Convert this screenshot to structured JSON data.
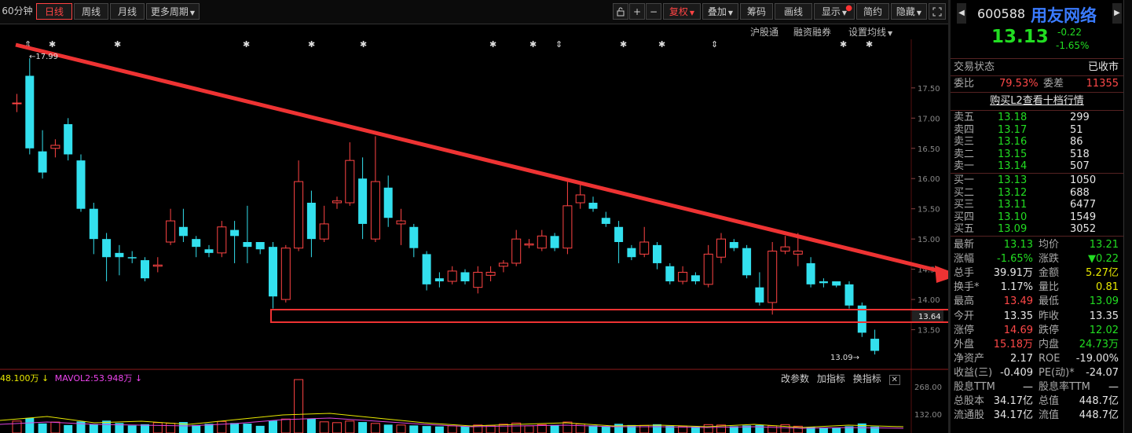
{
  "toolbar": {
    "period": "60分钟",
    "day": "日线",
    "week": "周线",
    "month": "月线",
    "more": "更多周期",
    "plus": "+",
    "minus": "−",
    "restore": "复权",
    "overlay": "叠加",
    "chips": "筹码",
    "draw": "画线",
    "display": "显示",
    "simple": "简约",
    "hide": "隐藏"
  },
  "subrow": {
    "hgt": "沪股通",
    "margin": "融资融券",
    "ma_setting": "设置均线"
  },
  "chart": {
    "y_ticks": [
      "17.50",
      "17.00",
      "16.50",
      "16.00",
      "15.50",
      "15.00",
      "14.50",
      "14.00",
      "13.50"
    ],
    "hi_label": "17.99",
    "lo_label": "13.09",
    "box_price": "13.64",
    "vol_legend_1": "48.100万 ↓",
    "vol_legend_2": "MAVOL2:53.948万 ↓",
    "vol_ticks": [
      "268.00",
      "132.00"
    ],
    "vol_buttons": [
      "改参数",
      "加指标",
      "换指标"
    ],
    "vol_close": "✕"
  },
  "chart_data": {
    "type": "candlestick",
    "ylim": [
      13.0,
      18.2
    ],
    "candles": [
      {
        "o": 17.25,
        "c": 17.25,
        "h": 17.4,
        "l": 17.1
      },
      {
        "o": 17.7,
        "c": 16.5,
        "h": 17.99,
        "l": 16.4
      },
      {
        "o": 16.45,
        "c": 16.1,
        "h": 16.8,
        "l": 16.0
      },
      {
        "o": 16.5,
        "c": 16.55,
        "h": 16.65,
        "l": 16.35
      },
      {
        "o": 16.9,
        "c": 16.4,
        "h": 17.0,
        "l": 16.3
      },
      {
        "o": 16.3,
        "c": 15.5,
        "h": 16.4,
        "l": 15.45
      },
      {
        "o": 15.5,
        "c": 15.0,
        "h": 15.6,
        "l": 14.75
      },
      {
        "o": 15.0,
        "c": 14.7,
        "h": 15.1,
        "l": 14.3
      },
      {
        "o": 14.77,
        "c": 14.7,
        "h": 14.9,
        "l": 14.4
      },
      {
        "o": 14.7,
        "c": 14.68,
        "h": 14.8,
        "l": 14.6
      },
      {
        "o": 14.65,
        "c": 14.35,
        "h": 14.7,
        "l": 14.3
      },
      {
        "o": 14.55,
        "c": 14.57,
        "h": 14.7,
        "l": 14.45
      },
      {
        "o": 14.95,
        "c": 15.3,
        "h": 15.5,
        "l": 14.9
      },
      {
        "o": 15.2,
        "c": 15.05,
        "h": 15.5,
        "l": 14.95
      },
      {
        "o": 15.0,
        "c": 14.87,
        "h": 15.05,
        "l": 14.7
      },
      {
        "o": 14.83,
        "c": 14.77,
        "h": 14.9,
        "l": 14.7
      },
      {
        "o": 14.77,
        "c": 15.2,
        "h": 15.3,
        "l": 14.7
      },
      {
        "o": 15.15,
        "c": 15.05,
        "h": 15.3,
        "l": 14.6
      },
      {
        "o": 14.95,
        "c": 14.87,
        "h": 15.55,
        "l": 14.6
      },
      {
        "o": 14.95,
        "c": 14.83,
        "h": 14.95,
        "l": 14.75
      },
      {
        "o": 14.87,
        "c": 14.05,
        "h": 14.95,
        "l": 13.85
      },
      {
        "o": 14.0,
        "c": 14.85,
        "h": 14.9,
        "l": 13.95
      },
      {
        "o": 14.85,
        "c": 15.95,
        "h": 16.3,
        "l": 14.8
      },
      {
        "o": 15.6,
        "c": 15.0,
        "h": 15.8,
        "l": 14.7
      },
      {
        "o": 15.0,
        "c": 15.25,
        "h": 15.55,
        "l": 14.95
      },
      {
        "o": 15.6,
        "c": 15.63,
        "h": 15.7,
        "l": 15.5
      },
      {
        "o": 15.6,
        "c": 16.3,
        "h": 16.6,
        "l": 15.55
      },
      {
        "o": 16.0,
        "c": 15.25,
        "h": 16.35,
        "l": 15.0
      },
      {
        "o": 15.0,
        "c": 15.95,
        "h": 16.7,
        "l": 14.95
      },
      {
        "o": 15.85,
        "c": 15.35,
        "h": 16.05,
        "l": 15.2
      },
      {
        "o": 15.25,
        "c": 15.3,
        "h": 15.5,
        "l": 14.9
      },
      {
        "o": 15.2,
        "c": 14.85,
        "h": 15.25,
        "l": 14.7
      },
      {
        "o": 14.75,
        "c": 14.25,
        "h": 14.8,
        "l": 14.15
      },
      {
        "o": 14.35,
        "c": 14.3,
        "h": 14.45,
        "l": 14.2
      },
      {
        "o": 14.3,
        "c": 14.47,
        "h": 14.55,
        "l": 14.25
      },
      {
        "o": 14.45,
        "c": 14.3,
        "h": 14.5,
        "l": 14.25
      },
      {
        "o": 14.2,
        "c": 14.45,
        "h": 14.55,
        "l": 14.1
      },
      {
        "o": 14.4,
        "c": 14.45,
        "h": 14.55,
        "l": 14.3
      },
      {
        "o": 14.55,
        "c": 14.6,
        "h": 14.65,
        "l": 14.45
      },
      {
        "o": 14.6,
        "c": 15.0,
        "h": 15.15,
        "l": 14.55
      },
      {
        "o": 14.9,
        "c": 14.92,
        "h": 15.0,
        "l": 14.85
      },
      {
        "o": 14.85,
        "c": 15.05,
        "h": 15.15,
        "l": 14.8
      },
      {
        "o": 15.05,
        "c": 14.85,
        "h": 15.1,
        "l": 14.8
      },
      {
        "o": 14.85,
        "c": 15.55,
        "h": 16.0,
        "l": 14.75
      },
      {
        "o": 15.6,
        "c": 15.73,
        "h": 15.95,
        "l": 15.5
      },
      {
        "o": 15.6,
        "c": 15.5,
        "h": 15.7,
        "l": 15.45
      },
      {
        "o": 15.35,
        "c": 15.25,
        "h": 15.45,
        "l": 15.2
      },
      {
        "o": 15.2,
        "c": 14.95,
        "h": 15.3,
        "l": 14.6
      },
      {
        "o": 14.85,
        "c": 14.7,
        "h": 14.9,
        "l": 14.65
      },
      {
        "o": 14.75,
        "c": 14.95,
        "h": 15.2,
        "l": 14.7
      },
      {
        "o": 14.9,
        "c": 14.6,
        "h": 14.95,
        "l": 14.5
      },
      {
        "o": 14.55,
        "c": 14.3,
        "h": 14.6,
        "l": 14.25
      },
      {
        "o": 14.3,
        "c": 14.45,
        "h": 14.55,
        "l": 14.25
      },
      {
        "o": 14.4,
        "c": 14.3,
        "h": 14.45,
        "l": 14.25
      },
      {
        "o": 14.25,
        "c": 14.75,
        "h": 14.9,
        "l": 14.2
      },
      {
        "o": 14.7,
        "c": 15.0,
        "h": 15.1,
        "l": 14.6
      },
      {
        "o": 14.95,
        "c": 14.85,
        "h": 15.0,
        "l": 14.8
      },
      {
        "o": 14.85,
        "c": 14.4,
        "h": 14.9,
        "l": 14.35
      },
      {
        "o": 14.2,
        "c": 13.95,
        "h": 14.45,
        "l": 13.9
      },
      {
        "o": 13.95,
        "c": 14.8,
        "h": 14.95,
        "l": 13.75
      },
      {
        "o": 14.8,
        "c": 14.87,
        "h": 15.05,
        "l": 14.75
      },
      {
        "o": 14.75,
        "c": 14.8,
        "h": 15.1,
        "l": 14.55
      },
      {
        "o": 14.6,
        "c": 14.25,
        "h": 14.7,
        "l": 14.2
      },
      {
        "o": 14.3,
        "c": 14.27,
        "h": 14.35,
        "l": 14.2
      },
      {
        "o": 14.3,
        "c": 14.23,
        "h": 14.3,
        "l": 14.2
      },
      {
        "o": 14.25,
        "c": 13.9,
        "h": 14.3,
        "l": 13.85
      },
      {
        "o": 13.9,
        "c": 13.45,
        "h": 13.95,
        "l": 13.38
      },
      {
        "o": 13.35,
        "c": 13.15,
        "h": 13.5,
        "l": 13.09
      }
    ],
    "volumes": [
      60,
      75,
      48,
      55,
      40,
      58,
      45,
      62,
      50,
      38,
      44,
      52,
      49,
      55,
      40,
      46,
      58,
      50,
      47,
      36,
      62,
      70,
      268,
      72,
      56,
      52,
      60,
      55,
      48,
      42,
      40,
      38,
      35,
      33,
      36,
      34,
      40,
      38,
      44,
      50,
      36,
      42,
      40,
      55,
      45,
      38,
      35,
      46,
      40,
      38,
      44,
      36,
      34,
      32,
      42,
      40,
      34,
      38,
      40,
      36,
      42,
      34,
      30,
      28,
      26,
      34,
      48,
      32
    ]
  },
  "panel": {
    "code": "600588",
    "name": "用友网络",
    "price": "13.13",
    "change": "-0.22",
    "change_pct": "-1.65%",
    "status_label": "交易状态",
    "status_value": "已收市",
    "weibi_label": "委比",
    "weibi_value": "79.53%",
    "weicha_label": "委差",
    "weicha_value": "11355",
    "l2_link": "购买L2查看十档行情",
    "sells": [
      {
        "label": "卖五",
        "price": "13.18",
        "vol": "299"
      },
      {
        "label": "卖四",
        "price": "13.17",
        "vol": "51"
      },
      {
        "label": "卖三",
        "price": "13.16",
        "vol": "86"
      },
      {
        "label": "卖二",
        "price": "13.15",
        "vol": "518"
      },
      {
        "label": "卖一",
        "price": "13.14",
        "vol": "507"
      }
    ],
    "buys": [
      {
        "label": "买一",
        "price": "13.13",
        "vol": "1050"
      },
      {
        "label": "买二",
        "price": "13.12",
        "vol": "688"
      },
      {
        "label": "买三",
        "price": "13.11",
        "vol": "6477"
      },
      {
        "label": "买四",
        "price": "13.10",
        "vol": "1549"
      },
      {
        "label": "买五",
        "price": "13.09",
        "vol": "3052"
      }
    ],
    "stats": [
      {
        "l1": "最新",
        "v1": "13.13",
        "c1": "green",
        "l2": "均价",
        "v2": "13.21",
        "c2": "green"
      },
      {
        "l1": "涨幅",
        "v1": "-1.65%",
        "c1": "green",
        "l2": "涨跌",
        "v2": "▼0.22",
        "c2": "green"
      },
      {
        "l1": "总手",
        "v1": "39.91万",
        "c1": "white",
        "l2": "金额",
        "v2": "5.27亿",
        "c2": "yel"
      },
      {
        "l1": "换手*",
        "v1": "1.17%",
        "c1": "white",
        "l2": "量比",
        "v2": "0.81",
        "c2": "yel"
      },
      {
        "l1": "最高",
        "v1": "13.49",
        "c1": "redt",
        "l2": "最低",
        "v2": "13.09",
        "c2": "green"
      },
      {
        "l1": "今开",
        "v1": "13.35",
        "c1": "white",
        "l2": "昨收",
        "v2": "13.35",
        "c2": "white"
      },
      {
        "l1": "涨停",
        "v1": "14.69",
        "c1": "redt",
        "l2": "跌停",
        "v2": "12.02",
        "c2": "green"
      },
      {
        "l1": "外盘",
        "v1": "15.18万",
        "c1": "redt",
        "l2": "内盘",
        "v2": "24.73万",
        "c2": "green"
      },
      {
        "l1": "净资产",
        "v1": "2.17",
        "c1": "white",
        "l2": "ROE",
        "v2": "-19.00%",
        "c2": "white"
      },
      {
        "l1": "收益(三)",
        "v1": "-0.409",
        "c1": "white",
        "l2": "PE(动)*",
        "v2": "-24.07",
        "c2": "white"
      },
      {
        "l1": "股息TTM",
        "v1": "—",
        "c1": "white",
        "l2": "股息率TTM",
        "v2": "—",
        "c2": "white"
      },
      {
        "l1": "总股本",
        "v1": "34.17亿",
        "c1": "white",
        "l2": "总值",
        "v2": "448.7亿",
        "c2": "white"
      },
      {
        "l1": "流通股",
        "v1": "34.17亿",
        "c1": "white",
        "l2": "流值",
        "v2": "448.7亿",
        "c2": "white"
      }
    ]
  },
  "colors": {
    "up": "#ff4444",
    "down": "#33e0ee",
    "trendline": "#ee3333",
    "box": "#ee3333"
  }
}
